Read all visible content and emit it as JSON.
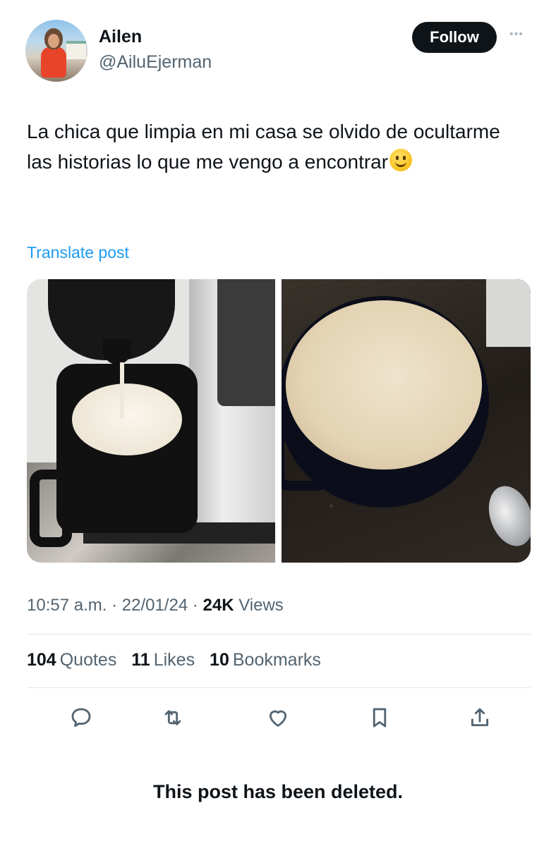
{
  "author": {
    "name": "Ailen",
    "handle": "@AiluEjerman",
    "follow_label": "Follow",
    "more_icon": "more-dots-icon"
  },
  "post": {
    "text": "La chica que limpia en mi casa se olvido de ocultarme las historias lo que me vengo a encontrar",
    "emoji": "slightly-smiling-face-emoji",
    "translate_label": "Translate post",
    "media": [
      {
        "kind": "photo",
        "subject": "milk pouring into black mug from coffee machine"
      },
      {
        "kind": "photo",
        "subject": "black mug with foamed milk on granite counter"
      }
    ]
  },
  "meta": {
    "time": "10:57 a.m.",
    "separator": "·",
    "date": "22/01/24",
    "views_count": "24K",
    "views_label": "Views"
  },
  "stats": [
    {
      "count": "104",
      "label": "Quotes"
    },
    {
      "count": "11",
      "label": "Likes"
    },
    {
      "count": "10",
      "label": "Bookmarks"
    }
  ],
  "actions": [
    {
      "name": "reply",
      "icon": "reply-icon"
    },
    {
      "name": "repost",
      "icon": "repost-icon"
    },
    {
      "name": "like",
      "icon": "heart-icon"
    },
    {
      "name": "bookmark",
      "icon": "bookmark-icon"
    },
    {
      "name": "share",
      "icon": "share-icon"
    }
  ],
  "notice": "This post has been deleted.",
  "colors": {
    "text": "#0f1419",
    "secondary": "#536471",
    "link": "#1d9bf0",
    "follow_bg": "#0f1419"
  }
}
